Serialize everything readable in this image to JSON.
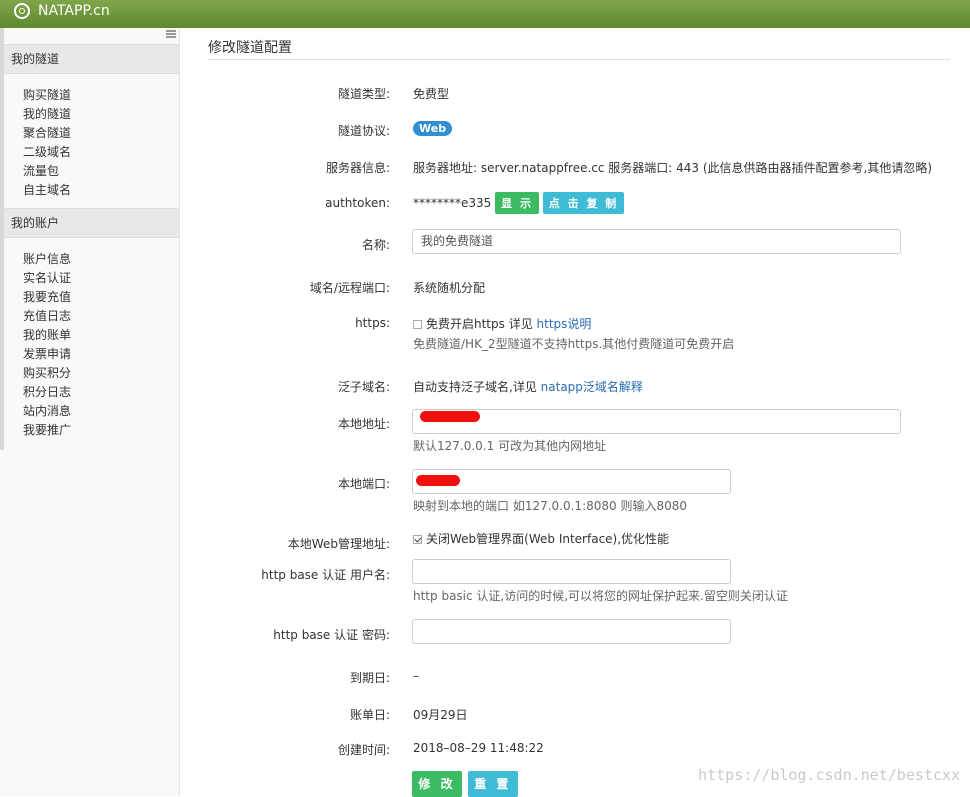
{
  "app": {
    "logo_text": "NATAPP.cn",
    "accent": "#6b9638"
  },
  "sidebar": {
    "groups": [
      {
        "title": "我的隧道",
        "items": [
          "购买隧道",
          "我的隧道",
          "聚合隧道",
          "二级域名",
          "流量包",
          "自主域名"
        ]
      },
      {
        "title": "我的账户",
        "items": [
          "账户信息",
          "实名认证",
          "我要充值",
          "充值日志",
          "我的账单",
          "发票申请",
          "购买积分",
          "积分日志",
          "站内消息",
          "我要推广"
        ]
      }
    ]
  },
  "page": {
    "title": "修改隧道配置"
  },
  "form": {
    "tunnel_type": {
      "label": "隧道类型:",
      "value": "免费型"
    },
    "protocol": {
      "label": "隧道协议:",
      "badge": "Web"
    },
    "server": {
      "label": "服务器信息:",
      "value": "服务器地址: server.natappfree.cc 服务器端口: 443 (此信息供路由器插件配置参考,其他请忽略)"
    },
    "authtoken": {
      "label": "authtoken:",
      "value": "********e335",
      "show_button": "显 示",
      "copy_button": "点 击 复 制"
    },
    "name": {
      "label": "名称:",
      "value": "我的免费隧道"
    },
    "domain": {
      "label": "域名/远程端口:",
      "value": "系统随机分配"
    },
    "https": {
      "label": "https:",
      "checkbox_text": "免费开启https 详见",
      "link": "https说明",
      "checked": false,
      "help": "免费隧道/HK_2型隧道不支持https.其他付费隧道可免费开启"
    },
    "wildcard": {
      "label": "泛子域名:",
      "text": "自动支持泛子域名,详见",
      "link": "natapp泛域名解释"
    },
    "local_addr": {
      "label": "本地地址:",
      "help": "默认127.0.0.1 可改为其他内网地址"
    },
    "local_port": {
      "label": "本地端口:",
      "help": "映射到本地的端口 如127.0.0.1:8080 则输入8080"
    },
    "web_admin": {
      "label": "本地Web管理地址:",
      "checkbox_text": "关闭Web管理界面(Web Interface),优化性能",
      "checked": true
    },
    "auth_user": {
      "label": "http base 认证 用户名:",
      "help": "http basic 认证,访问的时候,可以将您的网址保护起来.留空则关闭认证"
    },
    "auth_pass": {
      "label": "http base 认证 密码:"
    },
    "expire": {
      "label": "到期日:",
      "value": "–"
    },
    "bill_day": {
      "label": "账单日:",
      "value": "09月29日"
    },
    "created": {
      "label": "创建时间:",
      "value": "2018–08–29 11:48:22"
    },
    "submit": {
      "modify": "修 改",
      "reset": "重 置"
    }
  },
  "watermark": "https://blog.csdn.net/bestcxx"
}
